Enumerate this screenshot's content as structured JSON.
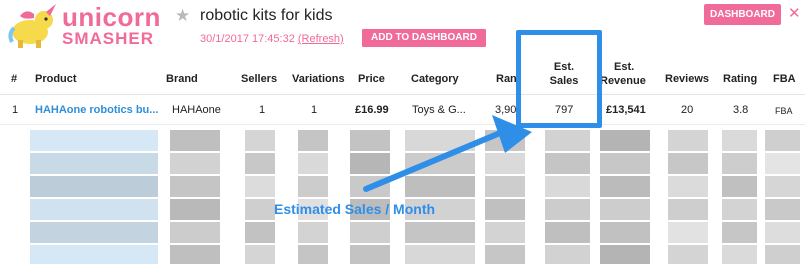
{
  "app": {
    "logo_line1": "unicorn",
    "logo_line2": "SMASHER",
    "search_query": "robotic kits for kids",
    "timestamp": "30/1/2017 17:45:32",
    "refresh_label": "(Refresh)",
    "add_to_dashboard_label": "ADD TO DASHBOARD",
    "dashboard_label": "DASHBOARD",
    "close_label": "✕",
    "star_label": "★"
  },
  "table": {
    "headers": {
      "num": "#",
      "product": "Product",
      "brand": "Brand",
      "sellers": "Sellers",
      "variations": "Variations",
      "price": "Price",
      "category": "Category",
      "rank": "Ran",
      "est_sales_l1": "Est.",
      "est_sales_l2": "Sales",
      "est_rev_l1": "Est.",
      "est_rev_l2": "Revenue",
      "reviews": "Reviews",
      "rating": "Rating",
      "fba": "FBA"
    },
    "rows": [
      {
        "num": "1",
        "product": "HAHAone robotics bu...",
        "brand": "HAHAone",
        "sellers": "1",
        "variations": "1",
        "price": "£16.99",
        "category": "Toys & G...",
        "rank": "3,90",
        "est_sales": "797",
        "est_revenue": "£13,541",
        "reviews": "20",
        "rating": "3.8",
        "fba": "FBA"
      }
    ]
  },
  "annotation": {
    "text": "Estimated Sales / Month",
    "color": "#2f8fe8"
  },
  "colors": {
    "brand_pink": "#f06a9a",
    "link_blue": "#2f8fd8",
    "callout_blue": "#2f8fe8"
  }
}
